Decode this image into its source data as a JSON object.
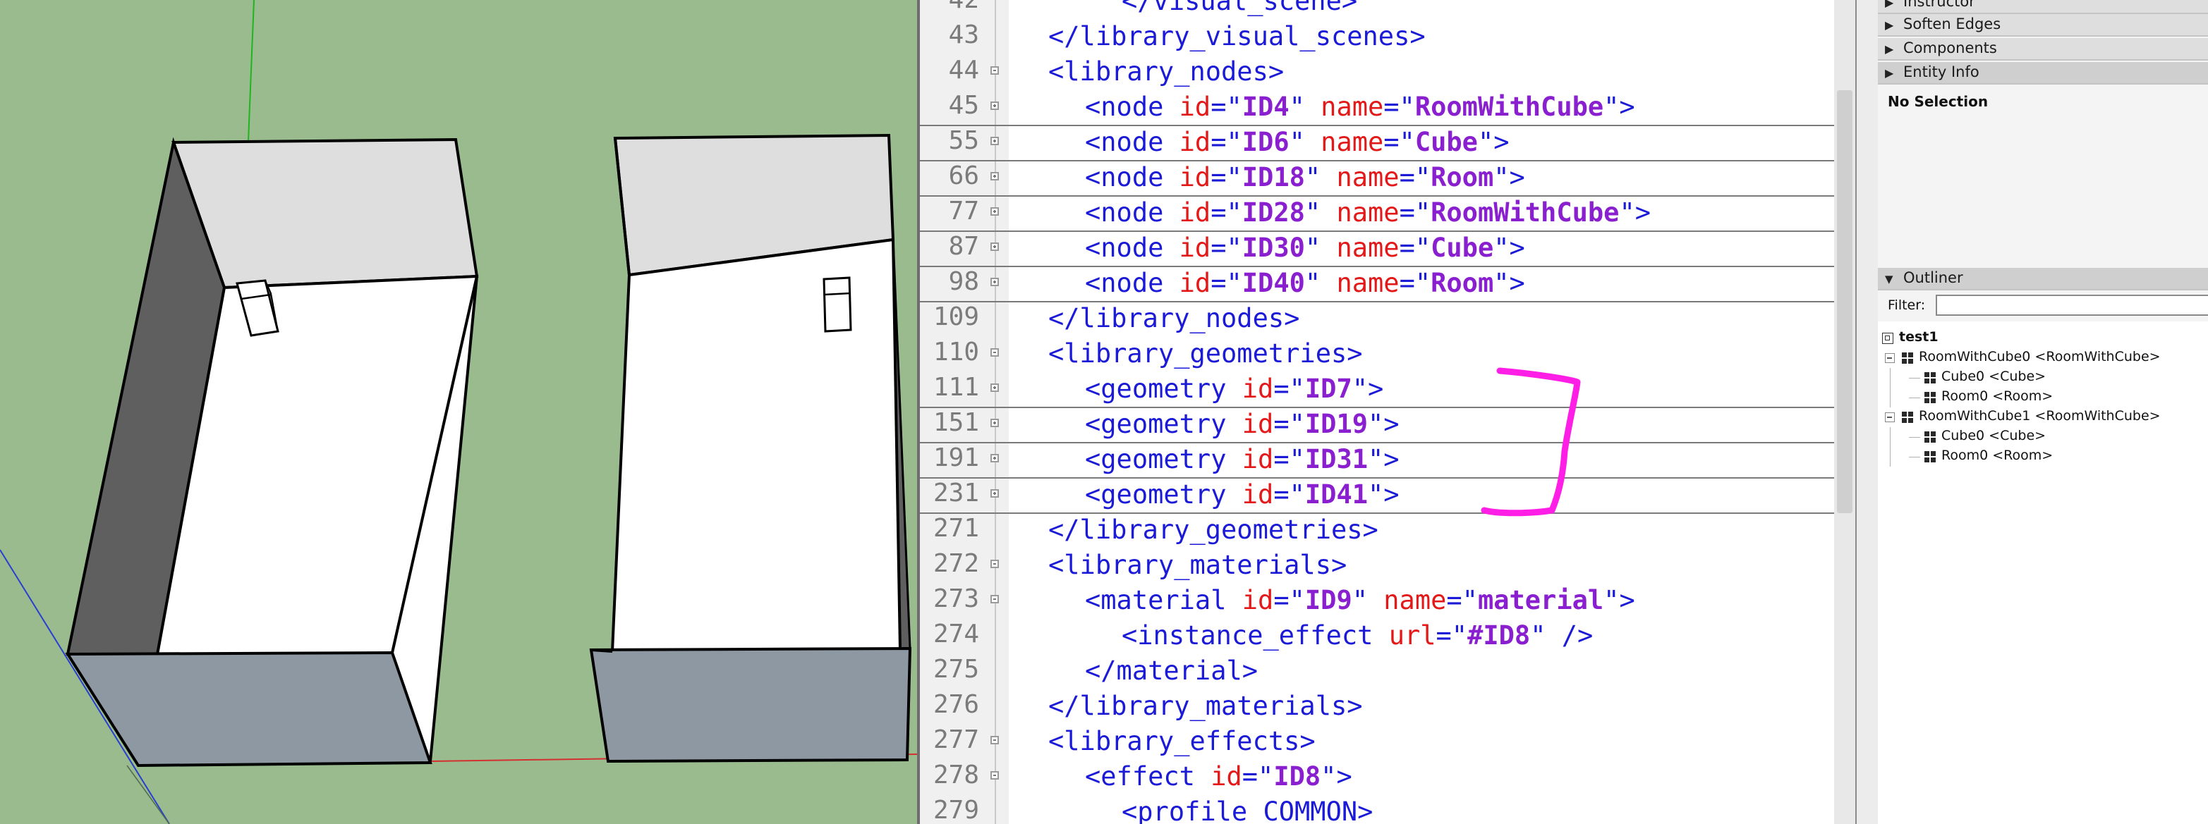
{
  "editor": {
    "lines": [
      {
        "num": "42",
        "indent": 3,
        "parts": [
          {
            "t": "tag",
            "s": "</visual_scene>"
          }
        ]
      },
      {
        "num": "43",
        "indent": 1,
        "parts": [
          {
            "t": "tag",
            "s": "</library_visual_scenes>"
          }
        ]
      },
      {
        "num": "44",
        "indent": 1,
        "fold": "minus",
        "parts": [
          {
            "t": "tag",
            "s": "<library_nodes>"
          }
        ]
      },
      {
        "num": "45",
        "indent": 2,
        "fold": "plus",
        "sep": true,
        "parts": [
          {
            "t": "tag",
            "s": "<node "
          },
          {
            "t": "attr",
            "s": "id"
          },
          {
            "t": "eq",
            "s": "=\""
          },
          {
            "t": "val",
            "s": "ID4"
          },
          {
            "t": "eq",
            "s": "\" "
          },
          {
            "t": "attr",
            "s": "name"
          },
          {
            "t": "eq",
            "s": "=\""
          },
          {
            "t": "val",
            "s": "RoomWithCube"
          },
          {
            "t": "tag",
            "s": "\">"
          }
        ]
      },
      {
        "num": "55",
        "indent": 2,
        "fold": "plus",
        "sep": true,
        "parts": [
          {
            "t": "tag",
            "s": "<node "
          },
          {
            "t": "attr",
            "s": "id"
          },
          {
            "t": "eq",
            "s": "=\""
          },
          {
            "t": "val",
            "s": "ID6"
          },
          {
            "t": "eq",
            "s": "\" "
          },
          {
            "t": "attr",
            "s": "name"
          },
          {
            "t": "eq",
            "s": "=\""
          },
          {
            "t": "val",
            "s": "Cube"
          },
          {
            "t": "tag",
            "s": "\">"
          }
        ]
      },
      {
        "num": "66",
        "indent": 2,
        "fold": "plus",
        "sep": true,
        "parts": [
          {
            "t": "tag",
            "s": "<node "
          },
          {
            "t": "attr",
            "s": "id"
          },
          {
            "t": "eq",
            "s": "=\""
          },
          {
            "t": "val",
            "s": "ID18"
          },
          {
            "t": "eq",
            "s": "\" "
          },
          {
            "t": "attr",
            "s": "name"
          },
          {
            "t": "eq",
            "s": "=\""
          },
          {
            "t": "val",
            "s": "Room"
          },
          {
            "t": "tag",
            "s": "\">"
          }
        ]
      },
      {
        "num": "77",
        "indent": 2,
        "fold": "plus",
        "sep": true,
        "parts": [
          {
            "t": "tag",
            "s": "<node "
          },
          {
            "t": "attr",
            "s": "id"
          },
          {
            "t": "eq",
            "s": "=\""
          },
          {
            "t": "val",
            "s": "ID28"
          },
          {
            "t": "eq",
            "s": "\" "
          },
          {
            "t": "attr",
            "s": "name"
          },
          {
            "t": "eq",
            "s": "=\""
          },
          {
            "t": "val",
            "s": "RoomWithCube"
          },
          {
            "t": "tag",
            "s": "\">"
          }
        ]
      },
      {
        "num": "87",
        "indent": 2,
        "fold": "plus",
        "sep": true,
        "parts": [
          {
            "t": "tag",
            "s": "<node "
          },
          {
            "t": "attr",
            "s": "id"
          },
          {
            "t": "eq",
            "s": "=\""
          },
          {
            "t": "val",
            "s": "ID30"
          },
          {
            "t": "eq",
            "s": "\" "
          },
          {
            "t": "attr",
            "s": "name"
          },
          {
            "t": "eq",
            "s": "=\""
          },
          {
            "t": "val",
            "s": "Cube"
          },
          {
            "t": "tag",
            "s": "\">"
          }
        ]
      },
      {
        "num": "98",
        "indent": 2,
        "fold": "plus",
        "sep": true,
        "parts": [
          {
            "t": "tag",
            "s": "<node "
          },
          {
            "t": "attr",
            "s": "id"
          },
          {
            "t": "eq",
            "s": "=\""
          },
          {
            "t": "val",
            "s": "ID40"
          },
          {
            "t": "eq",
            "s": "\" "
          },
          {
            "t": "attr",
            "s": "name"
          },
          {
            "t": "eq",
            "s": "=\""
          },
          {
            "t": "val",
            "s": "Room"
          },
          {
            "t": "tag",
            "s": "\">"
          }
        ]
      },
      {
        "num": "109",
        "indent": 1,
        "parts": [
          {
            "t": "tag",
            "s": "</library_nodes>"
          }
        ]
      },
      {
        "num": "110",
        "indent": 1,
        "fold": "minus",
        "parts": [
          {
            "t": "tag",
            "s": "<library_geometries>"
          }
        ]
      },
      {
        "num": "111",
        "indent": 2,
        "fold": "plus",
        "sep": true,
        "parts": [
          {
            "t": "tag",
            "s": "<geometry "
          },
          {
            "t": "attr",
            "s": "id"
          },
          {
            "t": "eq",
            "s": "=\""
          },
          {
            "t": "val",
            "s": "ID7"
          },
          {
            "t": "tag",
            "s": "\">"
          }
        ]
      },
      {
        "num": "151",
        "indent": 2,
        "fold": "plus",
        "sep": true,
        "parts": [
          {
            "t": "tag",
            "s": "<geometry "
          },
          {
            "t": "attr",
            "s": "id"
          },
          {
            "t": "eq",
            "s": "=\""
          },
          {
            "t": "val",
            "s": "ID19"
          },
          {
            "t": "tag",
            "s": "\">"
          }
        ]
      },
      {
        "num": "191",
        "indent": 2,
        "fold": "plus",
        "sep": true,
        "parts": [
          {
            "t": "tag",
            "s": "<geometry "
          },
          {
            "t": "attr",
            "s": "id"
          },
          {
            "t": "eq",
            "s": "=\""
          },
          {
            "t": "val",
            "s": "ID31"
          },
          {
            "t": "tag",
            "s": "\">"
          }
        ]
      },
      {
        "num": "231",
        "indent": 2,
        "fold": "plus",
        "sep": true,
        "parts": [
          {
            "t": "tag",
            "s": "<geometry "
          },
          {
            "t": "attr",
            "s": "id"
          },
          {
            "t": "eq",
            "s": "=\""
          },
          {
            "t": "val",
            "s": "ID41"
          },
          {
            "t": "tag",
            "s": "\">"
          }
        ]
      },
      {
        "num": "271",
        "indent": 1,
        "parts": [
          {
            "t": "tag",
            "s": "</library_geometries>"
          }
        ]
      },
      {
        "num": "272",
        "indent": 1,
        "fold": "minus",
        "parts": [
          {
            "t": "tag",
            "s": "<library_materials>"
          }
        ]
      },
      {
        "num": "273",
        "indent": 2,
        "fold": "minus",
        "parts": [
          {
            "t": "tag",
            "s": "<material "
          },
          {
            "t": "attr",
            "s": "id"
          },
          {
            "t": "eq",
            "s": "=\""
          },
          {
            "t": "val",
            "s": "ID9"
          },
          {
            "t": "eq",
            "s": "\" "
          },
          {
            "t": "attr",
            "s": "name"
          },
          {
            "t": "eq",
            "s": "=\""
          },
          {
            "t": "val",
            "s": "material"
          },
          {
            "t": "tag",
            "s": "\">"
          }
        ]
      },
      {
        "num": "274",
        "indent": 3,
        "parts": [
          {
            "t": "tag",
            "s": "<instance_effect "
          },
          {
            "t": "attr",
            "s": "url"
          },
          {
            "t": "eq",
            "s": "=\""
          },
          {
            "t": "val",
            "s": "#ID8"
          },
          {
            "t": "tag",
            "s": "\" />"
          }
        ]
      },
      {
        "num": "275",
        "indent": 2,
        "parts": [
          {
            "t": "tag",
            "s": "</material>"
          }
        ]
      },
      {
        "num": "276",
        "indent": 1,
        "parts": [
          {
            "t": "tag",
            "s": "</library_materials>"
          }
        ]
      },
      {
        "num": "277",
        "indent": 1,
        "fold": "minus",
        "parts": [
          {
            "t": "tag",
            "s": "<library_effects>"
          }
        ]
      },
      {
        "num": "278",
        "indent": 2,
        "fold": "minus",
        "parts": [
          {
            "t": "tag",
            "s": "<effect "
          },
          {
            "t": "attr",
            "s": "id"
          },
          {
            "t": "eq",
            "s": "=\""
          },
          {
            "t": "val",
            "s": "ID8"
          },
          {
            "t": "tag",
            "s": "\">"
          }
        ]
      },
      {
        "num": "279",
        "indent": 3,
        "parts": [
          {
            "t": "tag",
            "s": "<profile_COMMON>"
          }
        ]
      }
    ],
    "annotation_color": "#ff1ee6"
  },
  "trays": {
    "headers": {
      "instructor": "Instructor",
      "soften_edges": "Soften Edges",
      "components": "Components",
      "entity_info": "Entity Info",
      "outliner": "Outliner"
    },
    "entity_info": {
      "status": "No Selection"
    },
    "outliner": {
      "filter_label": "Filter:",
      "filter_value": "",
      "root": "test1",
      "items": [
        {
          "label": "RoomWithCube0 <RoomWithCube>",
          "level": 1,
          "toggle": true
        },
        {
          "label": "Cube0 <Cube>",
          "level": 2
        },
        {
          "label": "Room0 <Room>",
          "level": 2
        },
        {
          "label": "RoomWithCube1 <RoomWithCube>",
          "level": 1,
          "toggle": true
        },
        {
          "label": "Cube0 <Cube>",
          "level": 2
        },
        {
          "label": "Room0 <Room>",
          "level": 2
        }
      ]
    }
  },
  "colors": {
    "viewport_bg": "#99bb8e",
    "tag": "#1b1bd7",
    "attr": "#e31919",
    "value": "#8a1fcf"
  }
}
